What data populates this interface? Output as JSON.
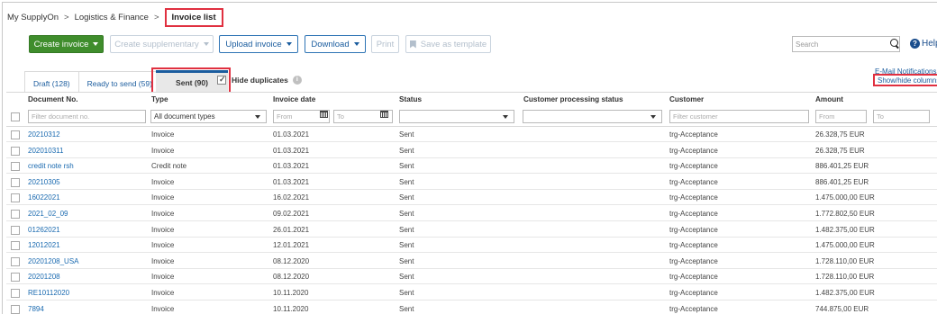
{
  "breadcrumb": {
    "root": "My SupplyOn",
    "sep": ">",
    "section": "Logistics & Finance",
    "current": "Invoice list"
  },
  "toolbar": {
    "create_invoice": "Create invoice",
    "create_supplementary": "Create supplementary",
    "upload_invoice": "Upload invoice",
    "download": "Download",
    "print": "Print",
    "save_template": "Save as template",
    "search_placeholder": "Search",
    "help": "Help"
  },
  "tabs": {
    "draft": "Draft (128)",
    "ready": "Ready to send (59)",
    "sent": "Sent (90)"
  },
  "hide_duplicates": "Hide duplicates",
  "links": {
    "email_notifications": "E-Mail Notifications",
    "show_hide_columns": "Show/hide columns"
  },
  "columns": {
    "document_no": "Document No.",
    "type": "Type",
    "invoice_date": "Invoice date",
    "status": "Status",
    "customer_processing_status": "Customer processing status",
    "customer": "Customer",
    "amount": "Amount"
  },
  "filters": {
    "document_no_placeholder": "Filter document no.",
    "type_value": "All document types",
    "date_from": "From",
    "date_to": "To",
    "customer_placeholder": "Filter customer",
    "amount_from": "From",
    "amount_to": "To"
  },
  "rows": [
    {
      "doc": "20210312",
      "type": "Invoice",
      "date": "01.03.2021",
      "status": "Sent",
      "customer": "trg-Acceptance",
      "amount": "26.328,75 EUR"
    },
    {
      "doc": "202010311",
      "type": "Invoice",
      "date": "01.03.2021",
      "status": "Sent",
      "customer": "trg-Acceptance",
      "amount": "26.328,75 EUR"
    },
    {
      "doc": "credit note rsh",
      "type": "Credit note",
      "date": "01.03.2021",
      "status": "Sent",
      "customer": "trg-Acceptance",
      "amount": "886.401,25 EUR"
    },
    {
      "doc": "20210305",
      "type": "Invoice",
      "date": "01.03.2021",
      "status": "Sent",
      "customer": "trg-Acceptance",
      "amount": "886.401,25 EUR"
    },
    {
      "doc": "16022021",
      "type": "Invoice",
      "date": "16.02.2021",
      "status": "Sent",
      "customer": "trg-Acceptance",
      "amount": "1.475.000,00 EUR"
    },
    {
      "doc": "2021_02_09",
      "type": "Invoice",
      "date": "09.02.2021",
      "status": "Sent",
      "customer": "trg-Acceptance",
      "amount": "1.772.802,50 EUR"
    },
    {
      "doc": "01262021",
      "type": "Invoice",
      "date": "26.01.2021",
      "status": "Sent",
      "customer": "trg-Acceptance",
      "amount": "1.482.375,00 EUR"
    },
    {
      "doc": "12012021",
      "type": "Invoice",
      "date": "12.01.2021",
      "status": "Sent",
      "customer": "trg-Acceptance",
      "amount": "1.475.000,00 EUR"
    },
    {
      "doc": "20201208_USA",
      "type": "Invoice",
      "date": "08.12.2020",
      "status": "Sent",
      "customer": "trg-Acceptance",
      "amount": "1.728.110,00 EUR"
    },
    {
      "doc": "20201208",
      "type": "Invoice",
      "date": "08.12.2020",
      "status": "Sent",
      "customer": "trg-Acceptance",
      "amount": "1.728.110,00 EUR"
    },
    {
      "doc": "RE10112020",
      "type": "Invoice",
      "date": "10.11.2020",
      "status": "Sent",
      "customer": "trg-Acceptance",
      "amount": "1.482.375,00 EUR"
    },
    {
      "doc": "7894",
      "type": "Invoice",
      "date": "10.11.2020",
      "status": "Sent",
      "customer": "trg-Acceptance",
      "amount": "744.875,00 EUR"
    }
  ],
  "colors": {
    "primary_green": "#3f8d2c",
    "link_blue": "#1a6ab0",
    "highlight_red": "#e03040",
    "tab_active_bar": "#1a5c9e"
  }
}
